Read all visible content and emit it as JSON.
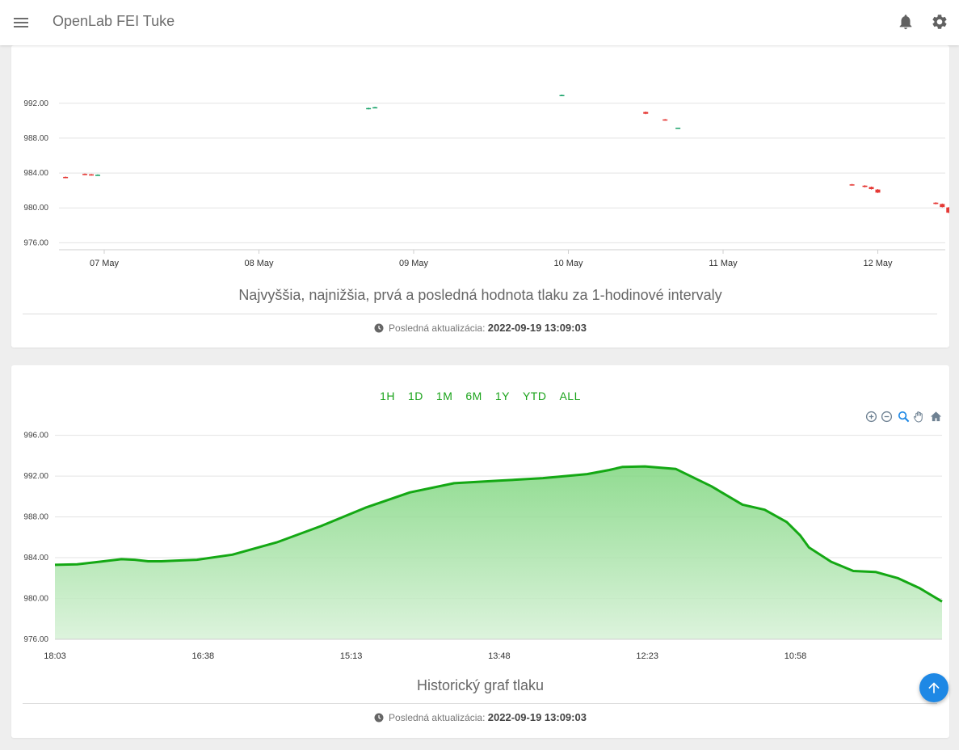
{
  "header": {
    "title": "OpenLab FEI Tuke",
    "icons": [
      "menu-icon",
      "bell-icon",
      "gear-icon"
    ]
  },
  "candle_card": {
    "caption": "Najvyššia, najnižšia, prvá a posledná hodnota tlaku za 1-hodinové intervaly",
    "updated_label": "Posledná aktualizácia:",
    "updated_value": "2022-09-19 13:09:03"
  },
  "history_card": {
    "ranges": [
      "1H",
      "1D",
      "1M",
      "6M",
      "1Y",
      "YTD",
      "ALL"
    ],
    "toolbar": [
      "zoom-in-icon",
      "zoom-out-icon",
      "zoom-selection-icon",
      "pan-hand-icon",
      "reset-home-icon"
    ],
    "caption": "Historický graf tlaku",
    "updated_label": "Posledná aktualizácia:",
    "updated_value": "2022-09-19 13:09:03"
  },
  "colors": {
    "up": "#1aa36a",
    "down": "#e53935",
    "line": "#14a814",
    "accent": "#1e88e5"
  },
  "chart_data": [
    {
      "type": "candlestick",
      "title": "",
      "ylim": [
        975.2,
        996.8
      ],
      "y_ticks": [
        "992.00",
        "988.00",
        "984.00",
        "980.00",
        "976.00"
      ],
      "x_ticks": [
        "07 May",
        "08 May",
        "09 May",
        "10 May",
        "11 May",
        "12 May"
      ],
      "x_start": "2022-05-06T17:00",
      "candles": [
        {
          "t": "2022-05-06T18:00",
          "open": 983.55,
          "high": 983.6,
          "low": 983.4,
          "close": 983.45
        },
        {
          "t": "2022-05-06T21:00",
          "open": 983.9,
          "high": 983.95,
          "low": 983.75,
          "close": 983.8
        },
        {
          "t": "2022-05-06T22:00",
          "open": 983.85,
          "high": 983.9,
          "low": 983.7,
          "close": 983.75
        },
        {
          "t": "2022-05-06T23:00",
          "open": 983.75,
          "high": 983.85,
          "low": 983.7,
          "close": 983.8
        },
        {
          "t": "2022-05-08T17:00",
          "open": 991.35,
          "high": 991.5,
          "low": 991.3,
          "close": 991.45
        },
        {
          "t": "2022-05-08T18:00",
          "open": 991.5,
          "high": 991.6,
          "low": 991.45,
          "close": 991.55
        },
        {
          "t": "2022-05-09T23:00",
          "open": 992.9,
          "high": 993.0,
          "low": 992.85,
          "close": 992.95
        },
        {
          "t": "2022-05-10T12:00",
          "open": 991.0,
          "high": 991.05,
          "low": 990.75,
          "close": 990.8
        },
        {
          "t": "2022-05-10T15:00",
          "open": 990.15,
          "high": 990.2,
          "low": 990.0,
          "close": 990.05
        },
        {
          "t": "2022-05-10T17:00",
          "open": 989.15,
          "high": 989.2,
          "low": 989.1,
          "close": 989.2
        },
        {
          "t": "2022-05-11T20:00",
          "open": 982.7,
          "high": 982.75,
          "low": 982.55,
          "close": 982.6
        },
        {
          "t": "2022-05-11T22:00",
          "open": 982.55,
          "high": 982.6,
          "low": 982.35,
          "close": 982.4
        },
        {
          "t": "2022-05-11T23:00",
          "open": 982.4,
          "high": 982.45,
          "low": 982.1,
          "close": 982.15
        },
        {
          "t": "2022-05-12T00:00",
          "open": 982.1,
          "high": 982.15,
          "low": 981.7,
          "close": 981.75
        },
        {
          "t": "2022-05-12T09:00",
          "open": 980.6,
          "high": 980.65,
          "low": 980.4,
          "close": 980.45
        },
        {
          "t": "2022-05-12T10:00",
          "open": 980.45,
          "high": 980.5,
          "low": 980.05,
          "close": 980.1
        },
        {
          "t": "2022-05-12T11:00",
          "open": 980.05,
          "high": 980.1,
          "low": 979.4,
          "close": 979.45
        }
      ]
    },
    {
      "type": "area",
      "title": "",
      "ylim": [
        976,
        997
      ],
      "y_ticks": [
        "996.00",
        "992.00",
        "988.00",
        "984.00",
        "980.00",
        "976.00"
      ],
      "x_ticks": [
        "18:03",
        "16:38",
        "15:13",
        "13:48",
        "12:23",
        "10:58"
      ],
      "x": [
        0,
        5,
        10,
        15,
        18,
        21,
        24,
        27,
        32,
        40,
        50,
        60,
        70,
        80,
        90,
        100,
        110,
        120,
        125,
        128,
        133,
        140,
        148,
        155,
        160,
        165,
        168,
        170,
        175,
        180,
        185,
        190,
        195,
        200
      ],
      "values": [
        983.3,
        983.35,
        983.6,
        983.85,
        983.8,
        983.65,
        983.65,
        983.7,
        983.8,
        984.3,
        985.5,
        987.1,
        988.9,
        990.4,
        991.3,
        991.55,
        991.8,
        992.2,
        992.6,
        992.9,
        992.95,
        992.7,
        991.0,
        989.2,
        988.7,
        987.5,
        986.2,
        985.0,
        983.6,
        982.7,
        982.6,
        982.0,
        981.0,
        979.7
      ]
    }
  ]
}
